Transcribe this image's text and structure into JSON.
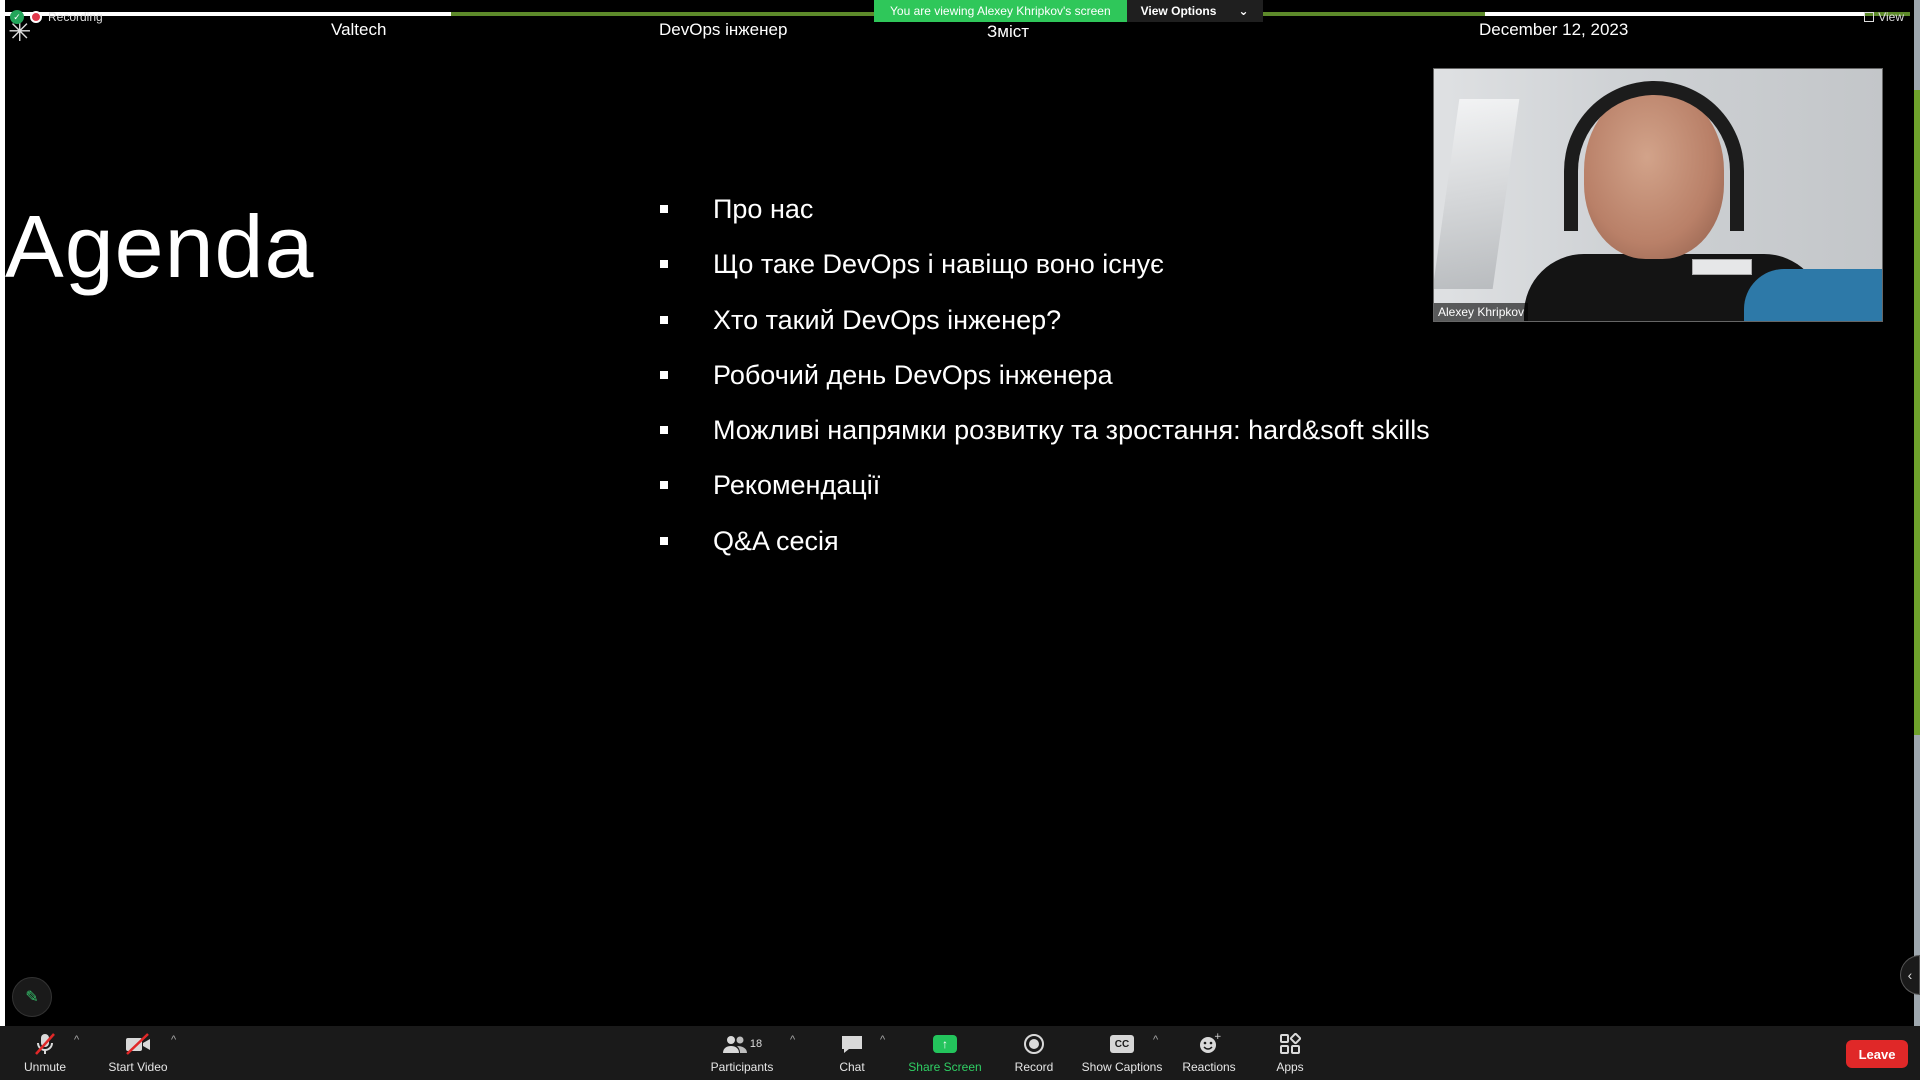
{
  "recording": {
    "label": "Recording"
  },
  "header": {
    "company": "Valtech",
    "topic": "DevOps інженер",
    "section": "Зміст",
    "date": "December 12, 2023"
  },
  "banner": {
    "viewing_text": "You are viewing Alexey Khripkov's screen",
    "view_options_label": "View Options"
  },
  "view_button": {
    "label": "View"
  },
  "slide": {
    "title": "Agenda",
    "items": [
      "Про нас",
      "Що таке DevOps і навіщо воно існує",
      "Хто такий DevOps інженер?",
      "Робочий день DevOps інженера",
      "Можливі напрямки розвитку та зростання: hard&soft skills",
      "Рекомендації",
      "Q&A сесія"
    ]
  },
  "video": {
    "participant_name": "Alexey Khripkov"
  },
  "toolbar": {
    "unmute": "Unmute",
    "start_video": "Start Video",
    "participants": "Participants",
    "participants_count": "18",
    "chat": "Chat",
    "share_screen": "Share Screen",
    "record": "Record",
    "show_captions": "Show Captions",
    "reactions": "Reactions",
    "apps": "Apps",
    "leave": "Leave"
  },
  "colors": {
    "share_green": "#2fc75a",
    "leave_red": "#e02828",
    "slide_accent": "#5d8a2a"
  }
}
